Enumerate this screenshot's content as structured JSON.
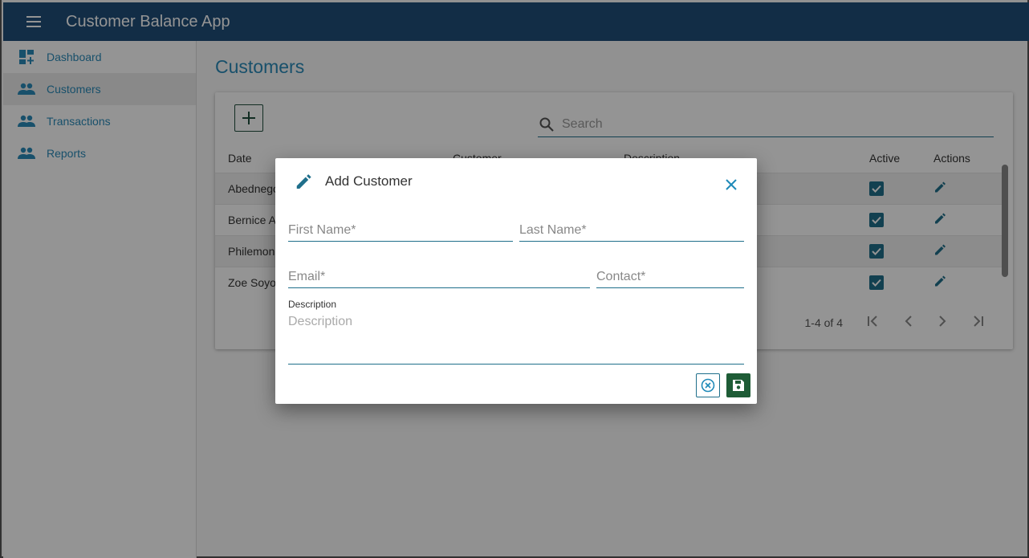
{
  "app": {
    "title": "Customer Balance App"
  },
  "sidebar": {
    "items": [
      {
        "label": "Dashboard",
        "icon": "dashboard-icon",
        "active": false
      },
      {
        "label": "Customers",
        "icon": "people-icon",
        "active": true
      },
      {
        "label": "Transactions",
        "icon": "people-icon",
        "active": false
      },
      {
        "label": "Reports",
        "icon": "people-icon",
        "active": false
      }
    ]
  },
  "page": {
    "title": "Customers"
  },
  "search": {
    "placeholder": "Search"
  },
  "table": {
    "columns": [
      "Date",
      "Customer",
      "Description",
      "Active",
      "Actions"
    ],
    "rows": [
      {
        "date": "Abednego",
        "active": true
      },
      {
        "date": "Bernice A",
        "active": true
      },
      {
        "date": "Philemon",
        "active": true
      },
      {
        "date": "Zoe Soyo",
        "active": true
      }
    ]
  },
  "pager": {
    "range": "1-4 of 4"
  },
  "dialog": {
    "title": "Add Customer",
    "first_name_placeholder": "First Name*",
    "last_name_placeholder": "Last Name*",
    "email_placeholder": "Email*",
    "contact_placeholder": "Contact*",
    "description_label": "Description",
    "description_placeholder": "Description"
  },
  "colors": {
    "appbar": "#1f4e79",
    "accent": "#2a8ab8",
    "save_button": "#1e5c36"
  }
}
